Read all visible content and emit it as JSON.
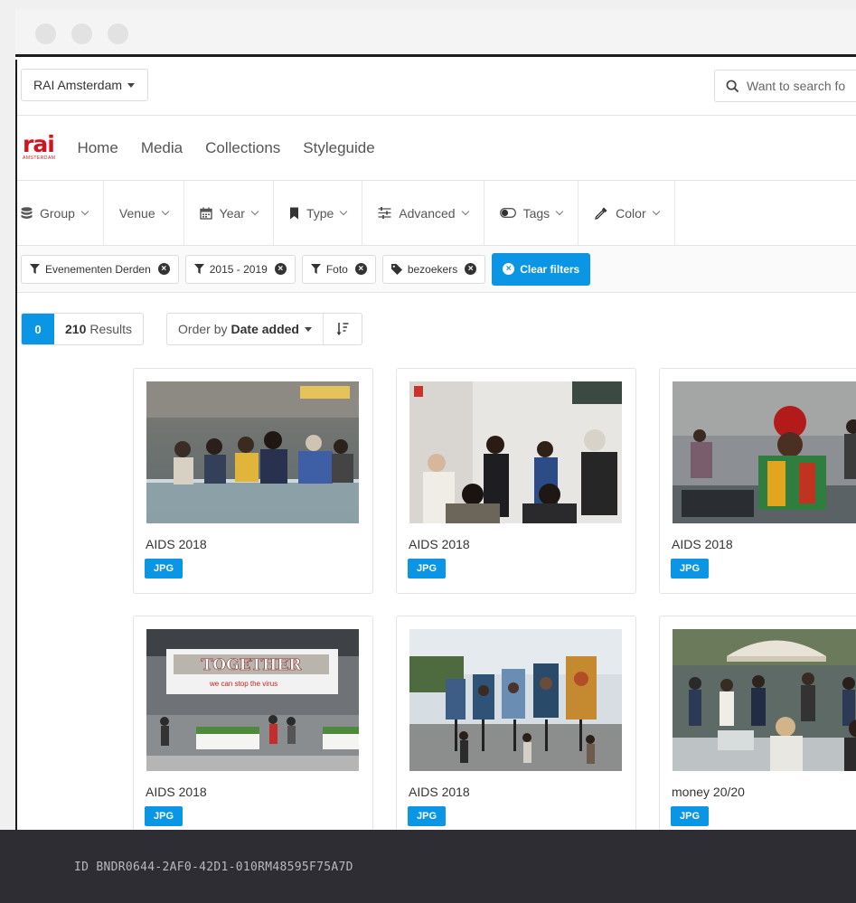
{
  "window": {
    "title": ""
  },
  "topbar": {
    "venue_select": "RAI Amsterdam",
    "search_placeholder": "Want to search fo"
  },
  "logo": {
    "word": "rai",
    "sub": "AMSTERDAM"
  },
  "nav": {
    "items": [
      "Home",
      "Media",
      "Collections",
      "Styleguide"
    ]
  },
  "filters": [
    {
      "label": "Group",
      "icon": "database-icon"
    },
    {
      "label": "Venue",
      "icon": ""
    },
    {
      "label": "Year",
      "icon": "calendar-icon"
    },
    {
      "label": "Type",
      "icon": "bookmark-icon"
    },
    {
      "label": "Advanced",
      "icon": "sliders-icon"
    },
    {
      "label": "Tags",
      "icon": "toggle-icon"
    },
    {
      "label": "Color",
      "icon": "eyedropper-icon"
    }
  ],
  "active_tags": [
    {
      "label": "Evenementen Derden",
      "icon": "filter-icon"
    },
    {
      "label": "2015 - 2019",
      "icon": "filter-icon"
    },
    {
      "label": "Foto",
      "icon": "filter-icon"
    },
    {
      "label": "bezoekers",
      "icon": "tag-icon"
    }
  ],
  "clear_filters": "Clear filters",
  "results": {
    "selected": "0",
    "count": "210",
    "label": "Results"
  },
  "order": {
    "prefix": "Order by",
    "value": "Date added"
  },
  "cards": [
    {
      "title": "AIDS 2018",
      "badge": "JPG"
    },
    {
      "title": "AIDS 2018",
      "badge": "JPG"
    },
    {
      "title": "AIDS 2018",
      "badge": "JPG"
    },
    {
      "title": "AIDS 2018",
      "badge": "JPG",
      "banner_text": "TOGETHER",
      "banner_sub": "we can stop the virus"
    },
    {
      "title": "AIDS 2018",
      "badge": "JPG"
    },
    {
      "title": "money 20/20",
      "badge": "JPG"
    }
  ],
  "footer": {
    "id": "ID BNDR0644-2AF0-42D1-010RM48595F75A7D"
  },
  "colors": {
    "accent": "#0a95e5",
    "brand": "#d4141c",
    "footer": "#2e2d33"
  }
}
